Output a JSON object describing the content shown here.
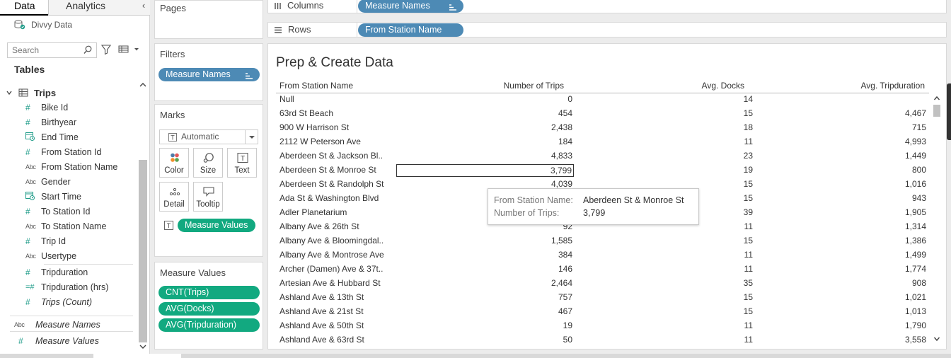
{
  "data_pane": {
    "tab_data": "Data",
    "tab_analytics": "Analytics",
    "collapse_glyph": "‹",
    "datasource": "Divvy Data",
    "search_placeholder": "Search",
    "tables_label": "Tables",
    "table_name": "Trips",
    "fields": [
      {
        "type": "#",
        "name": "Bike Id"
      },
      {
        "type": "#",
        "name": "Birthyear"
      },
      {
        "type": "date",
        "name": "End Time"
      },
      {
        "type": "#",
        "name": "From Station Id"
      },
      {
        "type": "Abc",
        "name": "From Station Name"
      },
      {
        "type": "Abc",
        "name": "Gender"
      },
      {
        "type": "date",
        "name": "Start Time"
      },
      {
        "type": "#",
        "name": "To Station Id"
      },
      {
        "type": "Abc",
        "name": "To Station Name"
      },
      {
        "type": "#",
        "name": "Trip Id"
      },
      {
        "type": "Abc",
        "name": "Usertype"
      },
      {
        "type": "#",
        "name": "Tripduration"
      },
      {
        "type": "=#",
        "name": "Tripduration (hrs)"
      },
      {
        "type": "#",
        "name": "Trips (Count)"
      }
    ],
    "measure_fields": [
      {
        "type": "Abc",
        "name": "Measure Names"
      },
      {
        "type": "#",
        "name": "Measure Values"
      }
    ]
  },
  "shelves": {
    "pages_label": "Pages",
    "filters_label": "Filters",
    "filter_pill": "Measure Names",
    "marks_label": "Marks",
    "mark_type": "Automatic",
    "mark_buttons": [
      "Color",
      "Size",
      "Text",
      "Detail",
      "Tooltip"
    ],
    "marks_measure_pill": "Measure Values",
    "measure_values_label": "Measure Values",
    "measure_values_pills": [
      "CNT(Trips)",
      "AVG(Docks)",
      "AVG(Tripduration)"
    ],
    "columns_label": "Columns",
    "columns_pill": "Measure Names",
    "rows_label": "Rows",
    "rows_pill": "From Station Name"
  },
  "viz": {
    "title": "Prep & Create Data",
    "headers": [
      "From Station Name",
      "Number of Trips",
      "Avg. Docks",
      "Avg. Tripduration"
    ],
    "rows": [
      [
        "Null",
        "0",
        "14",
        ""
      ],
      [
        "63rd St Beach",
        "454",
        "15",
        "4,467"
      ],
      [
        "900 W Harrison St",
        "2,438",
        "18",
        "715"
      ],
      [
        "2112 W Peterson Ave",
        "184",
        "11",
        "4,993"
      ],
      [
        "Aberdeen St & Jackson Bl..",
        "4,833",
        "23",
        "1,449"
      ],
      [
        "Aberdeen St & Monroe St",
        "3,799",
        "19",
        "800"
      ],
      [
        "Aberdeen St & Randolph St",
        "4,039",
        "15",
        "1,016"
      ],
      [
        "Ada St & Washington Blvd",
        "",
        "15",
        "943"
      ],
      [
        "Adler Planetarium",
        "",
        "39",
        "1,905"
      ],
      [
        "Albany Ave & 26th St",
        "92",
        "11",
        "1,314"
      ],
      [
        "Albany Ave & Bloomingdal..",
        "1,585",
        "15",
        "1,386"
      ],
      [
        "Albany Ave & Montrose Ave",
        "384",
        "11",
        "1,499"
      ],
      [
        "Archer (Damen) Ave & 37t..",
        "146",
        "11",
        "1,774"
      ],
      [
        "Artesian Ave & Hubbard St",
        "2,464",
        "35",
        "908"
      ],
      [
        "Ashland Ave & 13th St",
        "757",
        "15",
        "1,021"
      ],
      [
        "Ashland Ave & 21st St",
        "467",
        "15",
        "1,013"
      ],
      [
        "Ashland Ave & 50th St",
        "19",
        "11",
        "1,790"
      ],
      [
        "Ashland Ave & 63rd St",
        "50",
        "11",
        "3,558"
      ]
    ],
    "selected_row_index": 5,
    "tooltip": {
      "k1": "From Station Name:",
      "v1": "Aberdeen St & Monroe St",
      "k2": "Number of Trips:",
      "v2": "3,799"
    }
  },
  "colors": {
    "blue_pill": "#4d8ab5",
    "green_pill": "#12a980",
    "field_icon_teal": "#1f9c89"
  }
}
